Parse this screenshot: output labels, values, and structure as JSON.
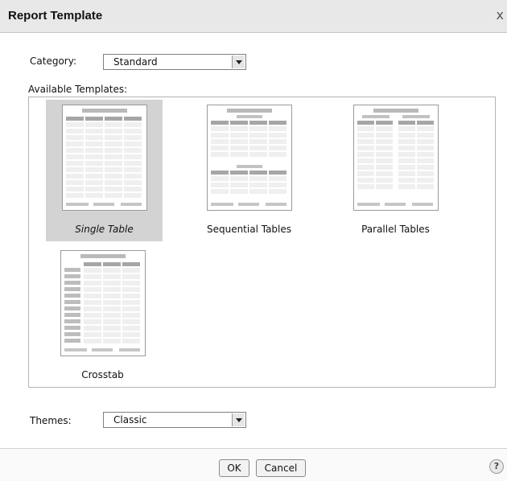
{
  "dialog": {
    "title": "Report Template",
    "close_label": "x"
  },
  "category": {
    "label": "Category:",
    "value": "Standard"
  },
  "templates": {
    "label": "Available Templates:",
    "items": [
      {
        "label": "Single Table",
        "selected": true
      },
      {
        "label": "Sequential Tables",
        "selected": false
      },
      {
        "label": "Parallel Tables",
        "selected": false
      },
      {
        "label": "Crosstab",
        "selected": false
      }
    ]
  },
  "themes": {
    "label": "Themes:",
    "value": "Classic"
  },
  "footer": {
    "ok_label": "OK",
    "cancel_label": "Cancel",
    "help_label": "?"
  }
}
